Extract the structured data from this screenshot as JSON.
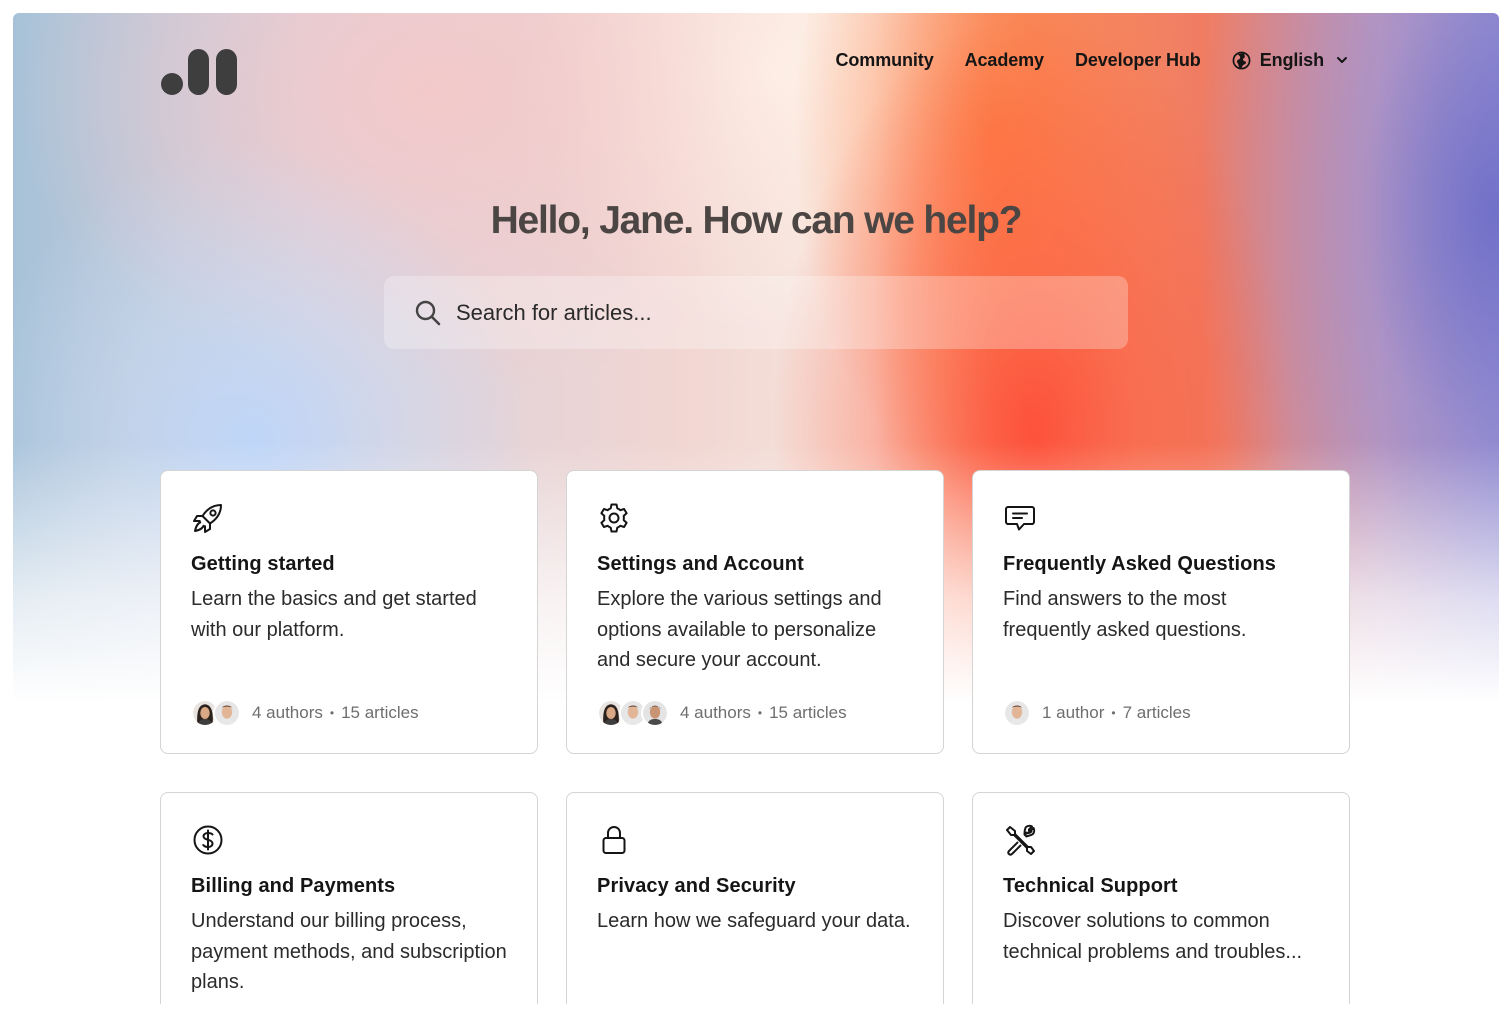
{
  "nav": {
    "links": [
      "Community",
      "Academy",
      "Developer Hub"
    ],
    "language": "English",
    "language_icon": "globe-icon",
    "language_chevron_icon": "chevron-down-icon"
  },
  "logo_icon": "brand-logo",
  "hero": {
    "greeting": "Hello, Jane. How can we help?"
  },
  "search": {
    "placeholder": "Search for articles...",
    "value": "",
    "icon": "search-icon"
  },
  "cards": [
    {
      "icon": "rocket-icon",
      "title": "Getting started",
      "description": "Learn the basics and get started with our platform.",
      "authors": "4 authors",
      "articles": "15 articles",
      "avatar_count_shown": 2
    },
    {
      "icon": "gear-icon",
      "title": "Settings and Account",
      "description": "Explore the various settings and options available to personalize and secure your account.",
      "authors": "4 authors",
      "articles": "15 articles",
      "avatar_count_shown": 3
    },
    {
      "icon": "chat-bubble-icon",
      "title": "Frequently Asked Questions",
      "description": "Find answers to the most frequently asked questions.",
      "authors": "1 author",
      "articles": "7 articles",
      "avatar_count_shown": 1
    },
    {
      "icon": "dollar-circle-icon",
      "title": "Billing and Payments",
      "description": "Understand our billing process, payment methods, and subscription plans."
    },
    {
      "icon": "lock-icon",
      "title": "Privacy and Security",
      "description": "Learn how we safeguard your data."
    },
    {
      "icon": "tools-icon",
      "title": "Technical Support",
      "description": "Discover solutions to common technical problems and troubles..."
    }
  ],
  "meta_separator": "•"
}
